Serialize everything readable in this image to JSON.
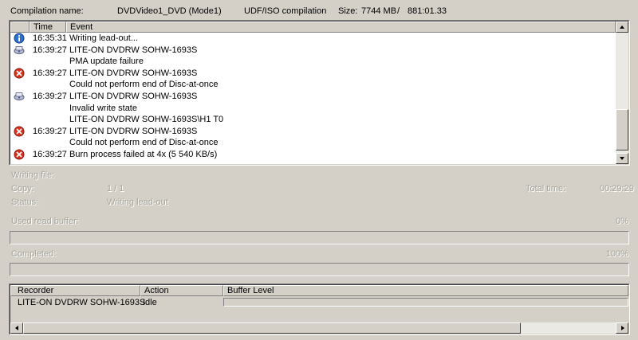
{
  "header": {
    "compilation_label": "Compilation name:",
    "compilation_name": "DVDVideo1_DVD (Mode1)",
    "compilation_type": "UDF/ISO compilation",
    "size_label": "Size:",
    "size_value": "7744 MB",
    "separator": "/",
    "duration": "881:01.33"
  },
  "log": {
    "columns": {
      "time": "Time",
      "event": "Event"
    },
    "rows": [
      {
        "icon": "info-icon",
        "time": "16:35:31",
        "event": "Writing lead-out..."
      },
      {
        "icon": "drive-icon",
        "time": "16:39:27",
        "event": "LITE-ON  DVDRW SOHW-1693S"
      },
      {
        "icon": "",
        "time": "",
        "event": "PMA update failure"
      },
      {
        "icon": "error-icon",
        "time": "16:39:27",
        "event": "LITE-ON  DVDRW SOHW-1693S"
      },
      {
        "icon": "",
        "time": "",
        "event": "Could not perform end of Disc-at-once"
      },
      {
        "icon": "drive-icon",
        "time": "16:39:27",
        "event": "LITE-ON  DVDRW SOHW-1693S"
      },
      {
        "icon": "",
        "time": "",
        "event": "Invalid write state"
      },
      {
        "icon": "",
        "time": "",
        "event": "LITE-ON  DVDRW SOHW-1693S\\H1 T0"
      },
      {
        "icon": "error-icon",
        "time": "16:39:27",
        "event": "LITE-ON  DVDRW SOHW-1693S"
      },
      {
        "icon": "",
        "time": "",
        "event": "Could not perform end of Disc-at-once"
      },
      {
        "icon": "error-icon",
        "time": "16:39:27",
        "event": "Burn process failed at 4x (5 540 KB/s)"
      }
    ]
  },
  "progress": {
    "writing_file_label": "Writing file:",
    "copy_label": "Copy:",
    "copy_value": "1 / 1",
    "total_time_label": "Total time:",
    "total_time_value": "00:29:29",
    "status_label": "Status:",
    "status_value": "Writing lead-out",
    "buffer_label": "Used read buffer:",
    "buffer_percent_text": "0%",
    "buffer_fraction": 0,
    "completed_label": "Completed:",
    "completed_percent_text": "100%",
    "completed_fraction": 1
  },
  "recorders": {
    "columns": {
      "recorder": "Recorder",
      "action": "Action",
      "buffer": "Buffer Level"
    },
    "rows": [
      {
        "recorder": "LITE-ON DVDRW SOHW-1693S",
        "action": "Idle",
        "buffer_fraction": 0
      }
    ]
  },
  "colors": {
    "window_bg": "#d4d0c8",
    "error_red": "#d8321e",
    "info_blue": "#2f6fd0",
    "disabled_text": "#a7a49c"
  }
}
